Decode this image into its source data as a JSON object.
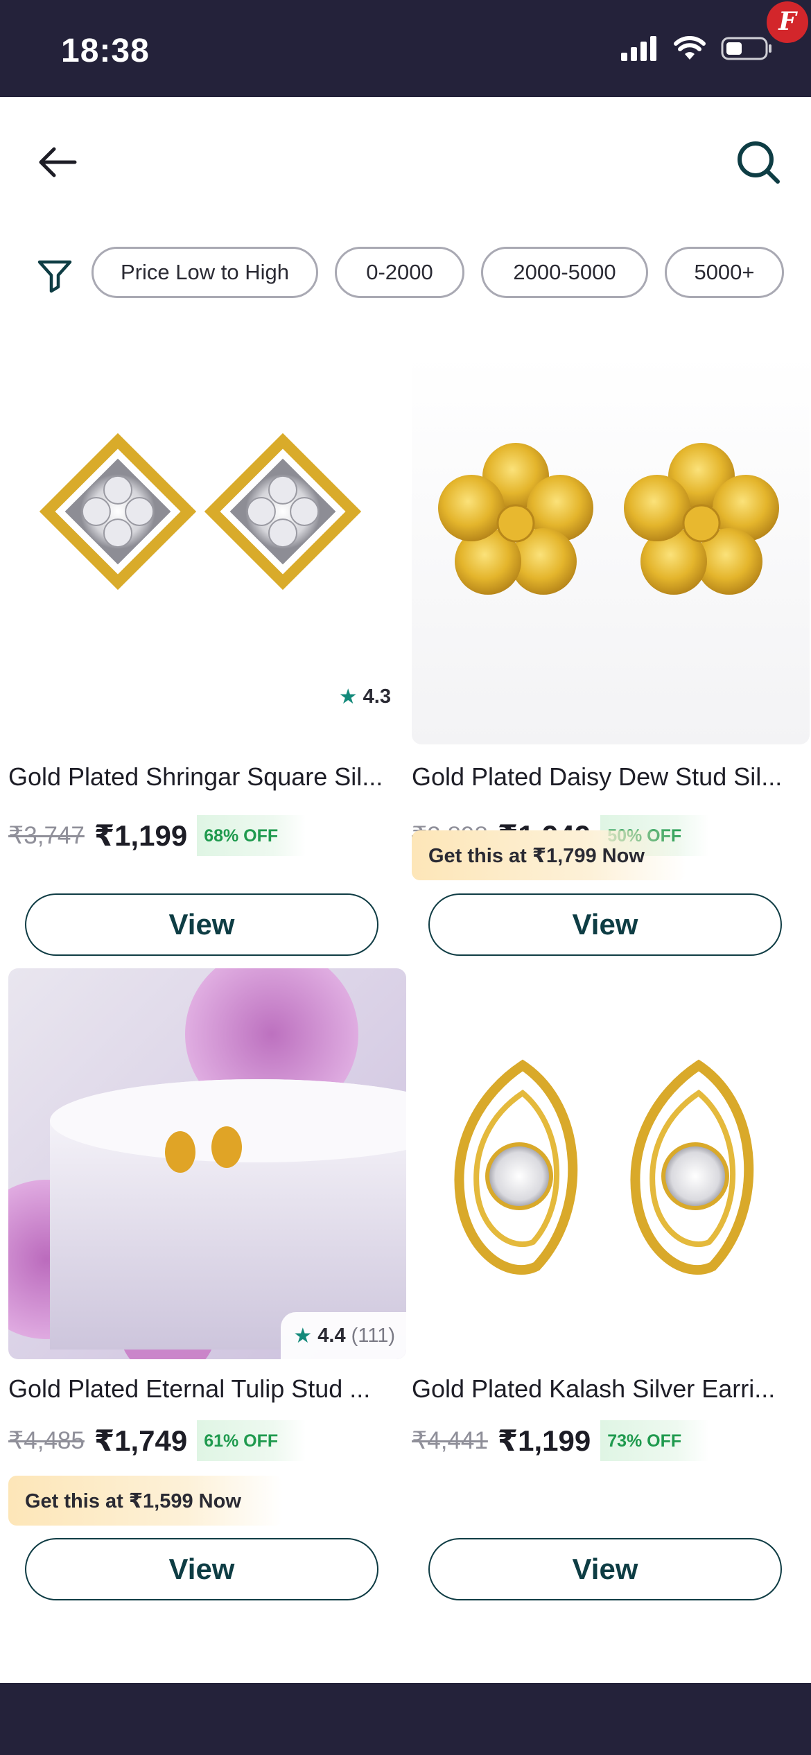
{
  "status_bar": {
    "time": "18:38"
  },
  "filters": {
    "chips": [
      "Price Low to High",
      "0-2000",
      "2000-5000",
      "5000+"
    ]
  },
  "products": [
    {
      "title": "Gold Plated Shringar Square Sil...",
      "mrp": "₹3,747",
      "price": "₹1,199",
      "discount": "68% OFF",
      "rating": "4.3",
      "view_label": "View"
    },
    {
      "title": "Gold Plated Daisy Dew Stud Sil...",
      "mrp": "₹3,898",
      "price": "₹1,949",
      "discount": "50% OFF",
      "offer": "Get this at ₹1,799 Now",
      "view_label": "View"
    },
    {
      "title": "Gold Plated Eternal Tulip Stud ...",
      "mrp": "₹4,485",
      "price": "₹1,749",
      "discount": "61% OFF",
      "rating": "4.4",
      "rating_count": "(111)",
      "offer": "Get this at ₹1,599 Now",
      "view_label": "View"
    },
    {
      "title": "Gold Plated Kalash Silver Earri...",
      "mrp": "₹4,441",
      "price": "₹1,199",
      "discount": "73% OFF",
      "view_label": "View"
    }
  ],
  "colors": {
    "status_bar": "#24223a",
    "accent": "#0e3d44",
    "discount": "#1f9a4e",
    "rating_star": "#13897a"
  },
  "icons": [
    "back-arrow-icon",
    "search-icon",
    "filter-icon",
    "signal-icon",
    "wifi-icon",
    "battery-icon",
    "star-icon"
  ]
}
